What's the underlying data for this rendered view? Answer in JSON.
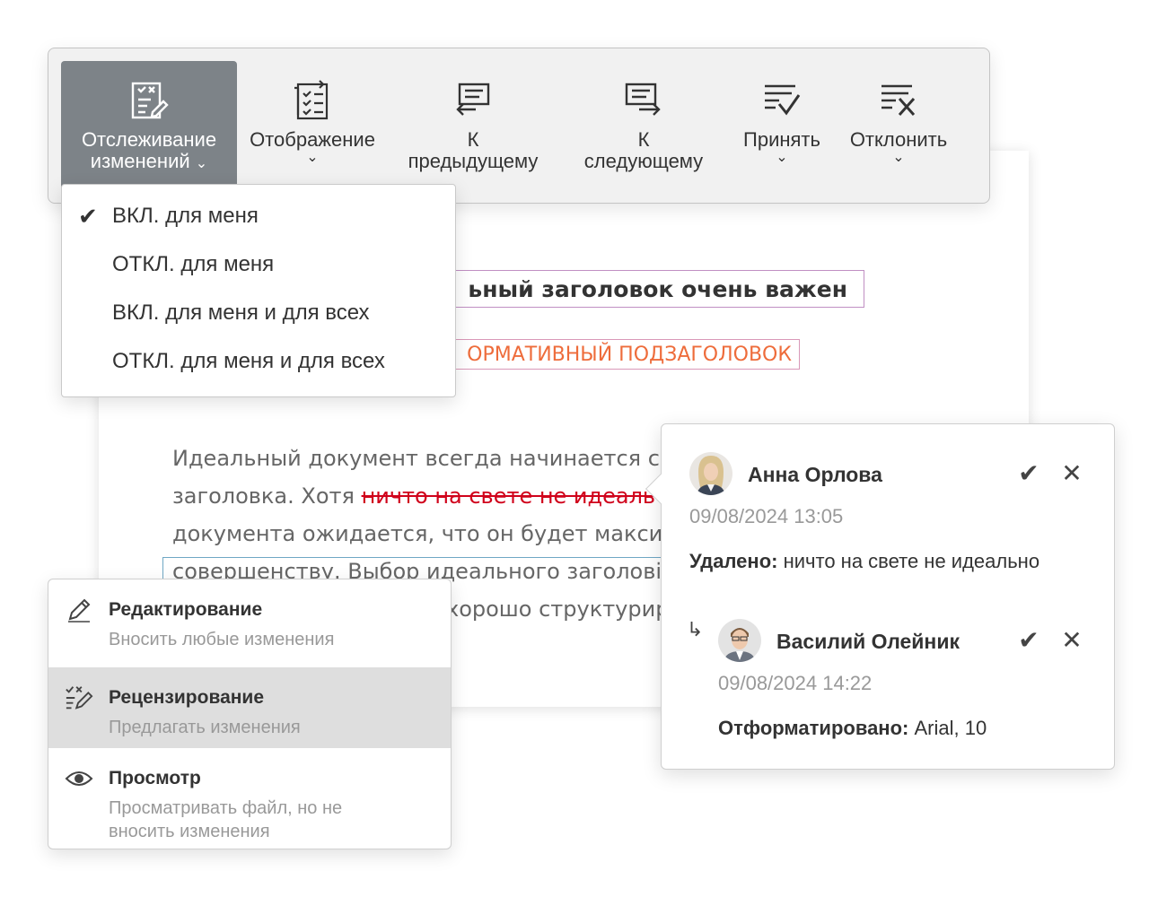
{
  "toolbar": {
    "track_changes_line1": "Отслеживание",
    "track_changes_line2": "изменений",
    "display_label": "Отображение",
    "prev_line1": "К",
    "prev_line2": "предыдущему",
    "next_line1": "К",
    "next_line2": "следующему",
    "accept_label": "Принять",
    "reject_label": "Отклонить"
  },
  "track_menu": {
    "items": [
      {
        "label": "ВКЛ. для меня",
        "checked": true
      },
      {
        "label": "ОТКЛ. для меня",
        "checked": false
      },
      {
        "label": "ВКЛ. для меня и для всех",
        "checked": false
      },
      {
        "label": "ОТКЛ. для меня и для всех",
        "checked": false
      }
    ]
  },
  "document": {
    "title": "ьный заголовок очень важен",
    "subtitle": "ОРМАТИВНЫЙ ПОДЗАГОЛОВОК",
    "line1": "Идеальный документ всегда начинается с",
    "line2_a": "заголовка. Хотя ",
    "line2_deleted": "ничто на свете не идеаль",
    "line3": "документа ожидается, что он будет максим",
    "line4": "совершенству. Выбор идеального заголові",
    "line5": "хорошо структурир"
  },
  "modes": {
    "items": [
      {
        "title": "Редактирование",
        "desc": "Вносить любые изменения",
        "icon": "pencil-icon",
        "selected": false
      },
      {
        "title": "Рецензирование",
        "desc": "Предлагать изменения",
        "icon": "review-icon",
        "selected": true
      },
      {
        "title": "Просмотр",
        "desc_line1": "Просматривать файл, но не",
        "desc_line2": "вносить изменения",
        "icon": "eye-icon",
        "selected": false
      }
    ]
  },
  "comments": {
    "first": {
      "author": "Анна Орлова",
      "date": "09/08/2024 13:05",
      "action_label": "Удалено:",
      "action_text": " ничто на свете не идеально"
    },
    "reply": {
      "author": "Василий Олейник",
      "date": "09/08/2024 14:22",
      "action_label": "Отформатировано:",
      "action_text": " Arial, 10"
    }
  }
}
